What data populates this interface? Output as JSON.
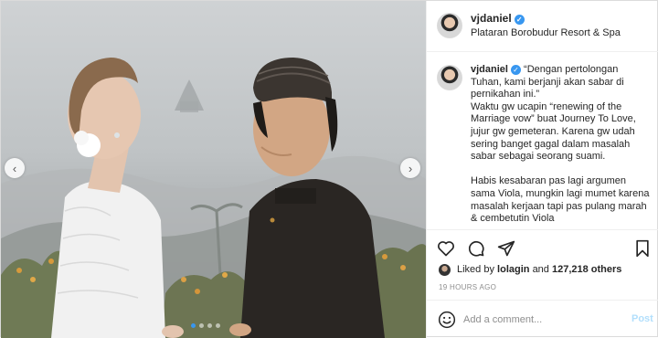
{
  "post": {
    "username": "vjdaniel",
    "location": "Plataran Borobudur Resort & Spa",
    "caption_lines": [
      "“Dengan pertolongan Tuhan, kami berjanji akan sabar di pernikahan ini.”",
      "Waktu gw ucapin “renewing of the Marriage vow” buat Journey To Love, jujur gw gemeteran. Karena gw udah sering banget gagal dalam masalah sabar sebagai seorang suami.",
      "Habis kesabaran pas lagi argumen sama Viola, mungkin lagi mumet karena masalah kerjaan tapi pas pulang marah & cembetutin Viola"
    ],
    "likes_prefix": "Liked by",
    "liked_by_user": "lolagin",
    "likes_connector": "and",
    "likes_count": "127,218 others",
    "timestamp": "19 HOURS AGO"
  },
  "comment": {
    "placeholder": "Add a comment...",
    "post_label": "Post"
  },
  "icons": {
    "verified": "verified-badge-icon",
    "like": "heart-icon",
    "comment": "comment-bubble-icon",
    "share": "paper-plane-icon",
    "save": "bookmark-icon",
    "emoji": "smiley-icon",
    "prev": "chevron-left-icon",
    "next": "chevron-right-icon"
  },
  "colors": {
    "verified_blue": "#3897f0",
    "post_button_disabled": "#b2dffc",
    "muted_text": "#8e8e8e",
    "border": "#efefef"
  },
  "carousel": {
    "total": 4,
    "active_index": 0
  }
}
